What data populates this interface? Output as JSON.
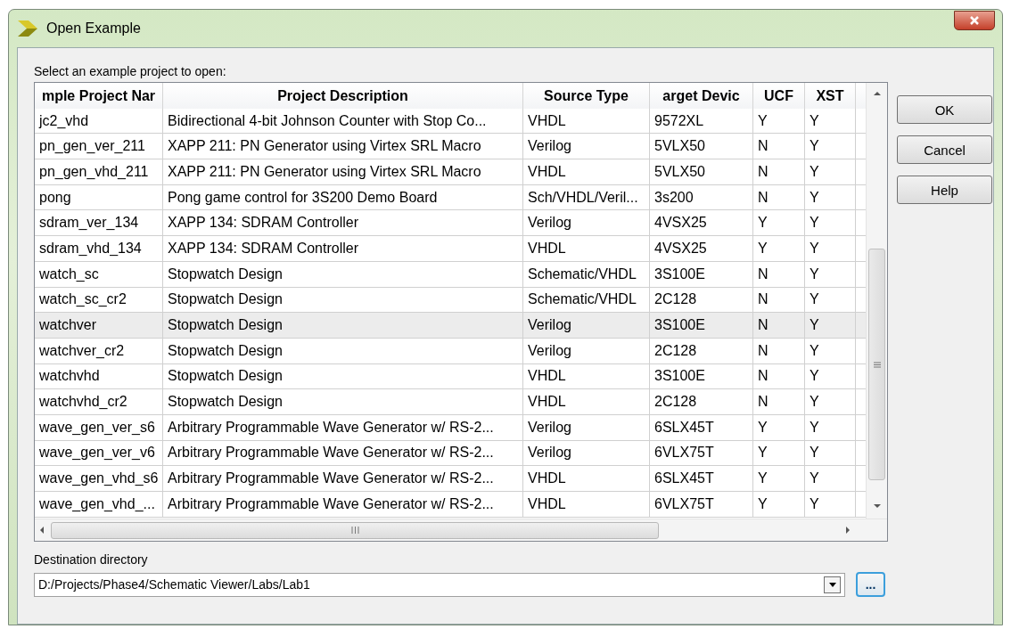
{
  "window": {
    "title": "Open Example"
  },
  "prompt": "Select an example project to open:",
  "table": {
    "columns": [
      "mple Project Nar",
      "Project Description",
      "Source Type",
      "arget Devic",
      "UCF",
      "XST"
    ],
    "rows": [
      {
        "cells": [
          "jc2_vhd",
          "Bidirectional 4-bit Johnson Counter with Stop Co...",
          "VHDL",
          "9572XL",
          "Y",
          "Y"
        ],
        "selected": false
      },
      {
        "cells": [
          "pn_gen_ver_211",
          "XAPP 211:  PN Generator using Virtex SRL Macro",
          "Verilog",
          "5VLX50",
          "N",
          "Y"
        ],
        "selected": false
      },
      {
        "cells": [
          "pn_gen_vhd_211",
          "XAPP 211:  PN Generator using Virtex SRL Macro",
          "VHDL",
          "5VLX50",
          "N",
          "Y"
        ],
        "selected": false
      },
      {
        "cells": [
          "pong",
          "Pong game control for 3S200 Demo Board",
          "Sch/VHDL/Veril...",
          "3s200",
          "N",
          "Y"
        ],
        "selected": false
      },
      {
        "cells": [
          "sdram_ver_134",
          "XAPP 134:  SDRAM Controller",
          "Verilog",
          "4VSX25",
          "Y",
          "Y"
        ],
        "selected": false
      },
      {
        "cells": [
          "sdram_vhd_134",
          "XAPP 134:  SDRAM Controller",
          "VHDL",
          "4VSX25",
          "Y",
          "Y"
        ],
        "selected": false
      },
      {
        "cells": [
          "watch_sc",
          "Stopwatch Design",
          "Schematic/VHDL",
          "3S100E",
          "N",
          "Y"
        ],
        "selected": false
      },
      {
        "cells": [
          "watch_sc_cr2",
          "Stopwatch Design",
          "Schematic/VHDL",
          "2C128",
          "N",
          "Y"
        ],
        "selected": false
      },
      {
        "cells": [
          "watchver",
          "Stopwatch Design",
          "Verilog",
          "3S100E",
          "N",
          "Y"
        ],
        "selected": true
      },
      {
        "cells": [
          "watchver_cr2",
          "Stopwatch Design",
          "Verilog",
          "2C128",
          "N",
          "Y"
        ],
        "selected": false
      },
      {
        "cells": [
          "watchvhd",
          "Stopwatch Design",
          "VHDL",
          "3S100E",
          "N",
          "Y"
        ],
        "selected": false
      },
      {
        "cells": [
          "watchvhd_cr2",
          "Stopwatch Design",
          "VHDL",
          "2C128",
          "N",
          "Y"
        ],
        "selected": false
      },
      {
        "cells": [
          "wave_gen_ver_s6",
          "Arbitrary Programmable Wave Generator w/ RS-2...",
          "Verilog",
          "6SLX45T",
          "Y",
          "Y"
        ],
        "selected": false
      },
      {
        "cells": [
          "wave_gen_ver_v6",
          "Arbitrary Programmable Wave Generator w/ RS-2...",
          "Verilog",
          "6VLX75T",
          "Y",
          "Y"
        ],
        "selected": false
      },
      {
        "cells": [
          "wave_gen_vhd_s6",
          "Arbitrary Programmable Wave Generator w/ RS-2...",
          "VHDL",
          "6SLX45T",
          "Y",
          "Y"
        ],
        "selected": false
      },
      {
        "cells": [
          "wave_gen_vhd_...",
          "Arbitrary Programmable Wave Generator w/ RS-2...",
          "VHDL",
          "6VLX75T",
          "Y",
          "Y"
        ],
        "selected": false
      }
    ]
  },
  "destination": {
    "label": "Destination directory",
    "value": "D:/Projects/Phase4/Schematic Viewer/Labs/Lab1",
    "browse": "..."
  },
  "buttons": [
    "OK",
    "Cancel",
    "Help"
  ]
}
